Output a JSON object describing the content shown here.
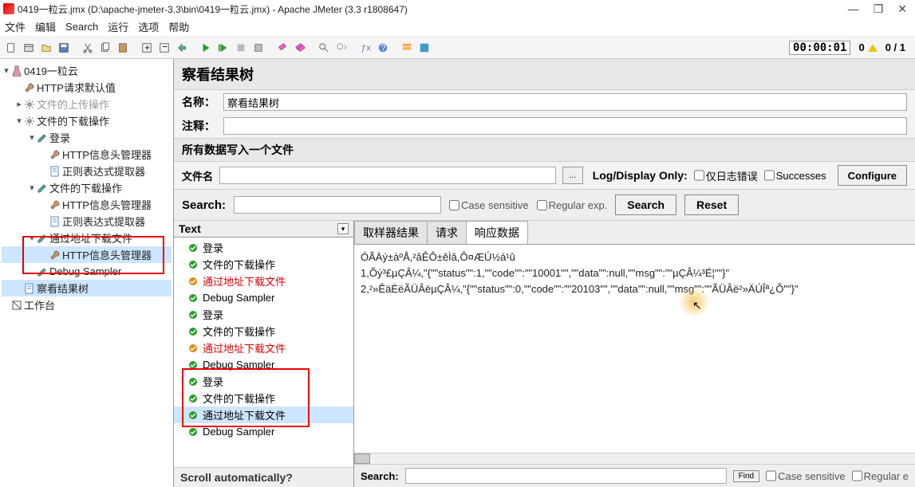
{
  "window": {
    "title": "0419一粒云.jmx (D:\\apache-jmeter-3.3\\bin\\0419一粒云.jmx) - Apache JMeter (3.3 r1808647)"
  },
  "menu": [
    "文件",
    "编辑",
    "Search",
    "运行",
    "选项",
    "帮助"
  ],
  "status": {
    "timer": "00:00:01",
    "warn": "0",
    "errors": "0 / 1"
  },
  "tree": [
    {
      "lvl": 0,
      "tog": "▾",
      "ico": "beaker",
      "txt": "0419一粒云",
      "grey": false
    },
    {
      "lvl": 1,
      "tog": " ",
      "ico": "wrench",
      "txt": "HTTP请求默认值",
      "grey": false
    },
    {
      "lvl": 1,
      "tog": "▸",
      "ico": "gear",
      "txt": "文件的上传操作",
      "grey": true
    },
    {
      "lvl": 1,
      "tog": "▾",
      "ico": "gear",
      "txt": "文件的下载操作",
      "grey": false
    },
    {
      "lvl": 2,
      "tog": "▾",
      "ico": "pencil",
      "txt": "登录",
      "grey": false
    },
    {
      "lvl": 3,
      "tog": " ",
      "ico": "wrench",
      "txt": "HTTP信息头管理器",
      "grey": false
    },
    {
      "lvl": 3,
      "tog": " ",
      "ico": "page",
      "txt": "正则表达式提取器",
      "grey": false
    },
    {
      "lvl": 2,
      "tog": "▾",
      "ico": "pencil",
      "txt": "文件的下载操作",
      "grey": false
    },
    {
      "lvl": 3,
      "tog": " ",
      "ico": "wrench",
      "txt": "HTTP信息头管理器",
      "grey": false
    },
    {
      "lvl": 3,
      "tog": " ",
      "ico": "page",
      "txt": "正则表达式提取器",
      "grey": false
    },
    {
      "lvl": 2,
      "tog": "▾",
      "ico": "pencil",
      "txt": "通过地址下载文件",
      "grey": false
    },
    {
      "lvl": 3,
      "tog": " ",
      "ico": "wrench",
      "txt": "HTTP信息头管理器",
      "grey": false,
      "sel": true
    },
    {
      "lvl": 2,
      "tog": " ",
      "ico": "pencil",
      "txt": "Debug Sampler",
      "grey": false
    },
    {
      "lvl": 1,
      "tog": " ",
      "ico": "page",
      "txt": "察看结果树",
      "grey": false,
      "sel": true
    },
    {
      "lvl": 0,
      "tog": " ",
      "ico": "square",
      "txt": "工作台",
      "grey": false
    }
  ],
  "panel": {
    "title": "察看结果树",
    "name_label": "名称：",
    "name_value": "察看结果树",
    "comment_label": "注释：",
    "section_label": "所有数据写入一个文件",
    "file_label": "文件名",
    "log_display": "Log/Display Only:",
    "only_errors": "仅日志错误",
    "successes": "Successes",
    "configure": "Configure",
    "search_label": "Search:",
    "case_sensitive": "Case sensitive",
    "regex": "Regular exp.",
    "search_btn": "Search",
    "reset_btn": "Reset"
  },
  "results": {
    "header": "Text",
    "scroll_label": "Scroll automatically?",
    "items": [
      {
        "ico": "green",
        "txt": "登录"
      },
      {
        "ico": "green",
        "txt": "文件的下载操作"
      },
      {
        "ico": "orange",
        "txt": "通过地址下载文件",
        "red": true
      },
      {
        "ico": "green",
        "txt": "Debug Sampler"
      },
      {
        "ico": "green",
        "txt": "登录"
      },
      {
        "ico": "green",
        "txt": "文件的下载操作"
      },
      {
        "ico": "orange",
        "txt": "通过地址下载文件",
        "red": true
      },
      {
        "ico": "green",
        "txt": "Debug Sampler"
      },
      {
        "ico": "green",
        "txt": "登录"
      },
      {
        "ico": "green",
        "txt": "文件的下载操作"
      },
      {
        "ico": "green",
        "txt": "通过地址下载文件",
        "sel": true
      },
      {
        "ico": "green",
        "txt": "Debug Sampler"
      }
    ]
  },
  "tabs": {
    "sampler": "取样器结果",
    "request": "请求",
    "response": "响应数据",
    "active": 2
  },
  "response": {
    "l1": "ÓÃÀý±àºÅ,²âÊÔ±êÌâ,Ô¤ÆÚ½á¹û",
    "l2": "1,Õý³£µÇÂ¼,\"{\"\"status\"\":1,\"\"code\"\":\"\"10001\"\",\"\"data\"\":null,\"\"msg\"\":\"\"µÇÂ¼³É¦\"\"}\"",
    "l3": "2,²»ÊäÈëÃÜÂëµÇÂ¼,\"{\"\"status\"\":0,\"\"code\"\":\"\"20103\"\",\"\"data\"\":null,\"\"msg\"\":\"\"ÃÜÂë²»ÄÚÎª¿Õ\"\"}\""
  },
  "bottom": {
    "search_label": "Search:",
    "find": "Find",
    "cs": "Case sensitive",
    "re": "Regular e"
  }
}
